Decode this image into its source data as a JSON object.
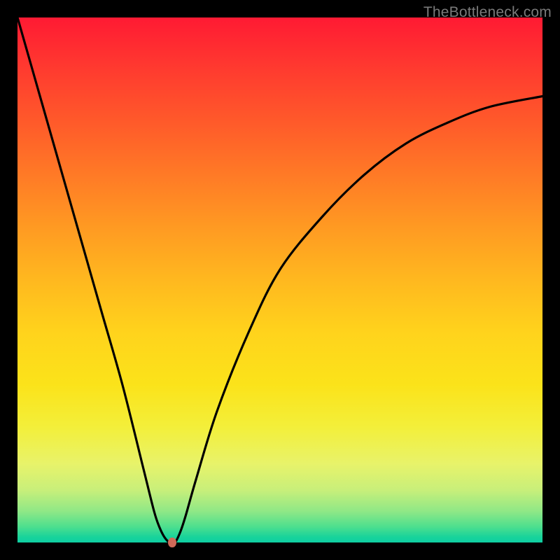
{
  "watermark": "TheBottleneck.com",
  "chart_data": {
    "type": "line",
    "title": "",
    "xlabel": "",
    "ylabel": "",
    "xlim": [
      0,
      100
    ],
    "ylim": [
      0,
      100
    ],
    "series": [
      {
        "name": "bottleneck-curve",
        "x": [
          0,
          4,
          8,
          12,
          16,
          20,
          24,
          26,
          27,
          28,
          29,
          30,
          31,
          32,
          34,
          38,
          44,
          50,
          58,
          66,
          74,
          82,
          90,
          100
        ],
        "values": [
          100,
          86,
          72,
          58,
          44,
          30,
          14,
          6,
          3,
          1,
          0,
          0,
          2,
          5,
          12,
          25,
          40,
          52,
          62,
          70,
          76,
          80,
          83,
          85
        ]
      }
    ],
    "annotations": [
      {
        "name": "min-marker",
        "x": 29.5,
        "y": 0
      }
    ],
    "background_gradient": {
      "top": "#ff1a33",
      "upper_mid": "#ff9a22",
      "lower_mid": "#f3ef3a",
      "bottom": "#0fcfa2"
    }
  }
}
